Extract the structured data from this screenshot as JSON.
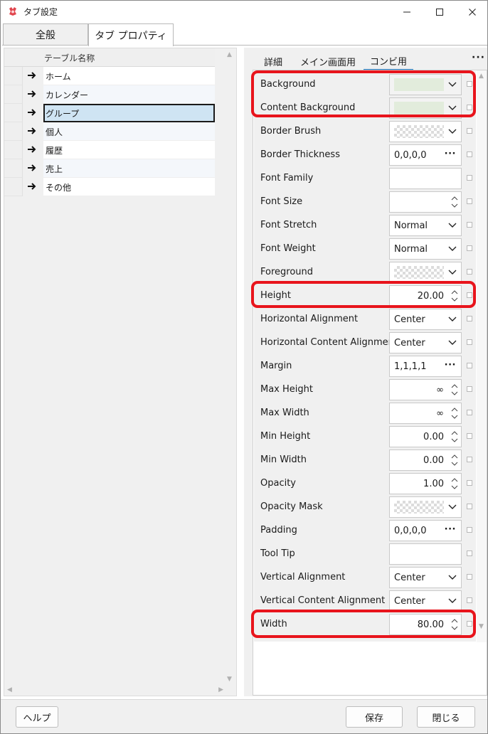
{
  "window": {
    "title": "タブ設定"
  },
  "tabs": [
    {
      "label": "全般",
      "active": false
    },
    {
      "label": "タブ プロパティ",
      "active": true
    }
  ],
  "table": {
    "header": "テーブル名称",
    "rows": [
      {
        "label": "ホーム"
      },
      {
        "label": "カレンダー"
      },
      {
        "label": "グループ",
        "selected": true
      },
      {
        "label": "個人"
      },
      {
        "label": "履歴"
      },
      {
        "label": "売上"
      },
      {
        "label": "その他"
      }
    ]
  },
  "subtabs": [
    {
      "label": "詳細",
      "active": false
    },
    {
      "label": "メイン画面用",
      "active": false
    },
    {
      "label": "コンビ用",
      "active": true
    }
  ],
  "properties": [
    {
      "label": "Background",
      "editor": "color",
      "swatch": "#e2ecdc",
      "highlighted": true
    },
    {
      "label": "Content Background",
      "editor": "color",
      "swatch": "#e2ecdc",
      "highlighted": true
    },
    {
      "label": "Border Brush",
      "editor": "brush"
    },
    {
      "label": "Border Thickness",
      "editor": "dots",
      "value": "0,0,0,0"
    },
    {
      "label": "Font Family",
      "editor": "text",
      "value": ""
    },
    {
      "label": "Font Size",
      "editor": "spin",
      "value": ""
    },
    {
      "label": "Font Stretch",
      "editor": "dropdown",
      "value": "Normal"
    },
    {
      "label": "Font Weight",
      "editor": "dropdown",
      "value": "Normal"
    },
    {
      "label": "Foreground",
      "editor": "brush"
    },
    {
      "label": "Height",
      "editor": "spin",
      "value": "20.00",
      "highlighted": true
    },
    {
      "label": "Horizontal Alignment",
      "editor": "dropdown",
      "value": "Center"
    },
    {
      "label": "Horizontal Content Alignment",
      "editor": "dropdown",
      "value": "Center"
    },
    {
      "label": "Margin",
      "editor": "dots",
      "value": "1,1,1,1"
    },
    {
      "label": "Max Height",
      "editor": "spin",
      "value": "∞"
    },
    {
      "label": "Max Width",
      "editor": "spin",
      "value": "∞"
    },
    {
      "label": "Min Height",
      "editor": "spin",
      "value": "0.00"
    },
    {
      "label": "Min Width",
      "editor": "spin",
      "value": "0.00"
    },
    {
      "label": "Opacity",
      "editor": "spin",
      "value": "1.00"
    },
    {
      "label": "Opacity Mask",
      "editor": "brush"
    },
    {
      "label": "Padding",
      "editor": "dots",
      "value": "0,0,0,0"
    },
    {
      "label": "Tool Tip",
      "editor": "text",
      "value": ""
    },
    {
      "label": "Vertical Alignment",
      "editor": "dropdown",
      "value": "Center"
    },
    {
      "label": "Vertical Content Alignment",
      "editor": "dropdown",
      "value": "Center"
    },
    {
      "label": "Width",
      "editor": "spin",
      "value": "80.00",
      "highlighted": true
    }
  ],
  "footer": {
    "help_label": "ヘルプ",
    "save_label": "保存",
    "close_label": "閉じる"
  },
  "colors": {
    "highlight": "#e8141c",
    "selection": "#cfe4f3",
    "accent": "#1f6fb8"
  }
}
